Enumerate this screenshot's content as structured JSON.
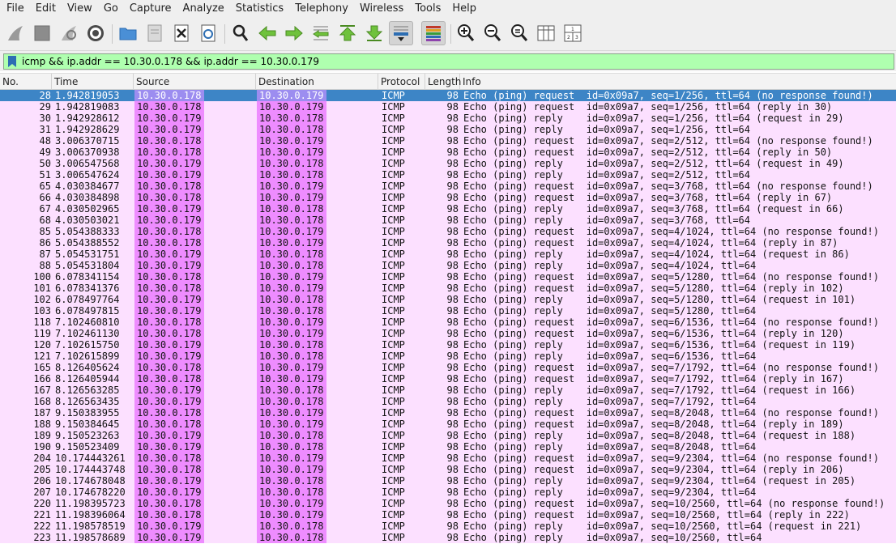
{
  "menubar": [
    "File",
    "Edit",
    "View",
    "Go",
    "Capture",
    "Analyze",
    "Statistics",
    "Telephony",
    "Wireless",
    "Tools",
    "Help"
  ],
  "toolbar": {
    "icons": [
      "shark-fin-start-icon",
      "stop-icon",
      "restart-icon",
      "options-gear-icon",
      "open-folder-icon",
      "save-file-icon",
      "close-file-icon",
      "reload-icon",
      "find-magnifier-icon",
      "go-back-arrow-icon",
      "go-forward-arrow-icon",
      "go-to-packet-icon",
      "go-first-icon",
      "go-last-icon",
      "autoscroll-icon",
      "colorize-icon",
      "zoom-in-icon",
      "zoom-out-icon",
      "zoom-normal-icon",
      "resize-columns-icon",
      "layout-icon"
    ]
  },
  "filter": {
    "value": "icmp && ip.addr == 10.30.0.178 && ip.addr == 10.30.0.179"
  },
  "columns": [
    "No.",
    "Time",
    "Source",
    "Destination",
    "Protocol",
    "Length",
    "Info"
  ],
  "packets": [
    {
      "no": "28",
      "time": "1.942819053",
      "src": "10.30.0.178",
      "dst": "10.30.0.179",
      "proto": "ICMP",
      "len": "98",
      "info": "Echo (ping) request  id=0x09a7, seq=1/256, ttl=64 (no response found!)",
      "selected": true
    },
    {
      "no": "29",
      "time": "1.942819083",
      "src": "10.30.0.178",
      "dst": "10.30.0.179",
      "proto": "ICMP",
      "len": "98",
      "info": "Echo (ping) request  id=0x09a7, seq=1/256, ttl=64 (reply in 30)"
    },
    {
      "no": "30",
      "time": "1.942928612",
      "src": "10.30.0.179",
      "dst": "10.30.0.178",
      "proto": "ICMP",
      "len": "98",
      "info": "Echo (ping) reply    id=0x09a7, seq=1/256, ttl=64 (request in 29)"
    },
    {
      "no": "31",
      "time": "1.942928629",
      "src": "10.30.0.179",
      "dst": "10.30.0.178",
      "proto": "ICMP",
      "len": "98",
      "info": "Echo (ping) reply    id=0x09a7, seq=1/256, ttl=64"
    },
    {
      "no": "48",
      "time": "3.006370715",
      "src": "10.30.0.178",
      "dst": "10.30.0.179",
      "proto": "ICMP",
      "len": "98",
      "info": "Echo (ping) request  id=0x09a7, seq=2/512, ttl=64 (no response found!)"
    },
    {
      "no": "49",
      "time": "3.006370938",
      "src": "10.30.0.178",
      "dst": "10.30.0.179",
      "proto": "ICMP",
      "len": "98",
      "info": "Echo (ping) request  id=0x09a7, seq=2/512, ttl=64 (reply in 50)"
    },
    {
      "no": "50",
      "time": "3.006547568",
      "src": "10.30.0.179",
      "dst": "10.30.0.178",
      "proto": "ICMP",
      "len": "98",
      "info": "Echo (ping) reply    id=0x09a7, seq=2/512, ttl=64 (request in 49)"
    },
    {
      "no": "51",
      "time": "3.006547624",
      "src": "10.30.0.179",
      "dst": "10.30.0.178",
      "proto": "ICMP",
      "len": "98",
      "info": "Echo (ping) reply    id=0x09a7, seq=2/512, ttl=64"
    },
    {
      "no": "65",
      "time": "4.030384677",
      "src": "10.30.0.178",
      "dst": "10.30.0.179",
      "proto": "ICMP",
      "len": "98",
      "info": "Echo (ping) request  id=0x09a7, seq=3/768, ttl=64 (no response found!)"
    },
    {
      "no": "66",
      "time": "4.030384898",
      "src": "10.30.0.178",
      "dst": "10.30.0.179",
      "proto": "ICMP",
      "len": "98",
      "info": "Echo (ping) request  id=0x09a7, seq=3/768, ttl=64 (reply in 67)"
    },
    {
      "no": "67",
      "time": "4.030502965",
      "src": "10.30.0.179",
      "dst": "10.30.0.178",
      "proto": "ICMP",
      "len": "98",
      "info": "Echo (ping) reply    id=0x09a7, seq=3/768, ttl=64 (request in 66)"
    },
    {
      "no": "68",
      "time": "4.030503021",
      "src": "10.30.0.179",
      "dst": "10.30.0.178",
      "proto": "ICMP",
      "len": "98",
      "info": "Echo (ping) reply    id=0x09a7, seq=3/768, ttl=64"
    },
    {
      "no": "85",
      "time": "5.054388333",
      "src": "10.30.0.178",
      "dst": "10.30.0.179",
      "proto": "ICMP",
      "len": "98",
      "info": "Echo (ping) request  id=0x09a7, seq=4/1024, ttl=64 (no response found!)"
    },
    {
      "no": "86",
      "time": "5.054388552",
      "src": "10.30.0.178",
      "dst": "10.30.0.179",
      "proto": "ICMP",
      "len": "98",
      "info": "Echo (ping) request  id=0x09a7, seq=4/1024, ttl=64 (reply in 87)"
    },
    {
      "no": "87",
      "time": "5.054531751",
      "src": "10.30.0.179",
      "dst": "10.30.0.178",
      "proto": "ICMP",
      "len": "98",
      "info": "Echo (ping) reply    id=0x09a7, seq=4/1024, ttl=64 (request in 86)"
    },
    {
      "no": "88",
      "time": "5.054531804",
      "src": "10.30.0.179",
      "dst": "10.30.0.178",
      "proto": "ICMP",
      "len": "98",
      "info": "Echo (ping) reply    id=0x09a7, seq=4/1024, ttl=64"
    },
    {
      "no": "100",
      "time": "6.078341154",
      "src": "10.30.0.178",
      "dst": "10.30.0.179",
      "proto": "ICMP",
      "len": "98",
      "info": "Echo (ping) request  id=0x09a7, seq=5/1280, ttl=64 (no response found!)"
    },
    {
      "no": "101",
      "time": "6.078341376",
      "src": "10.30.0.178",
      "dst": "10.30.0.179",
      "proto": "ICMP",
      "len": "98",
      "info": "Echo (ping) request  id=0x09a7, seq=5/1280, ttl=64 (reply in 102)"
    },
    {
      "no": "102",
      "time": "6.078497764",
      "src": "10.30.0.179",
      "dst": "10.30.0.178",
      "proto": "ICMP",
      "len": "98",
      "info": "Echo (ping) reply    id=0x09a7, seq=5/1280, ttl=64 (request in 101)"
    },
    {
      "no": "103",
      "time": "6.078497815",
      "src": "10.30.0.179",
      "dst": "10.30.0.178",
      "proto": "ICMP",
      "len": "98",
      "info": "Echo (ping) reply    id=0x09a7, seq=5/1280, ttl=64"
    },
    {
      "no": "118",
      "time": "7.102460810",
      "src": "10.30.0.178",
      "dst": "10.30.0.179",
      "proto": "ICMP",
      "len": "98",
      "info": "Echo (ping) request  id=0x09a7, seq=6/1536, ttl=64 (no response found!)"
    },
    {
      "no": "119",
      "time": "7.102461130",
      "src": "10.30.0.178",
      "dst": "10.30.0.179",
      "proto": "ICMP",
      "len": "98",
      "info": "Echo (ping) request  id=0x09a7, seq=6/1536, ttl=64 (reply in 120)"
    },
    {
      "no": "120",
      "time": "7.102615750",
      "src": "10.30.0.179",
      "dst": "10.30.0.178",
      "proto": "ICMP",
      "len": "98",
      "info": "Echo (ping) reply    id=0x09a7, seq=6/1536, ttl=64 (request in 119)"
    },
    {
      "no": "121",
      "time": "7.102615899",
      "src": "10.30.0.179",
      "dst": "10.30.0.178",
      "proto": "ICMP",
      "len": "98",
      "info": "Echo (ping) reply    id=0x09a7, seq=6/1536, ttl=64"
    },
    {
      "no": "165",
      "time": "8.126405624",
      "src": "10.30.0.178",
      "dst": "10.30.0.179",
      "proto": "ICMP",
      "len": "98",
      "info": "Echo (ping) request  id=0x09a7, seq=7/1792, ttl=64 (no response found!)"
    },
    {
      "no": "166",
      "time": "8.126405944",
      "src": "10.30.0.178",
      "dst": "10.30.0.179",
      "proto": "ICMP",
      "len": "98",
      "info": "Echo (ping) request  id=0x09a7, seq=7/1792, ttl=64 (reply in 167)"
    },
    {
      "no": "167",
      "time": "8.126563285",
      "src": "10.30.0.179",
      "dst": "10.30.0.178",
      "proto": "ICMP",
      "len": "98",
      "info": "Echo (ping) reply    id=0x09a7, seq=7/1792, ttl=64 (request in 166)"
    },
    {
      "no": "168",
      "time": "8.126563435",
      "src": "10.30.0.179",
      "dst": "10.30.0.178",
      "proto": "ICMP",
      "len": "98",
      "info": "Echo (ping) reply    id=0x09a7, seq=7/1792, ttl=64"
    },
    {
      "no": "187",
      "time": "9.150383955",
      "src": "10.30.0.178",
      "dst": "10.30.0.179",
      "proto": "ICMP",
      "len": "98",
      "info": "Echo (ping) request  id=0x09a7, seq=8/2048, ttl=64 (no response found!)"
    },
    {
      "no": "188",
      "time": "9.150384645",
      "src": "10.30.0.178",
      "dst": "10.30.0.179",
      "proto": "ICMP",
      "len": "98",
      "info": "Echo (ping) request  id=0x09a7, seq=8/2048, ttl=64 (reply in 189)"
    },
    {
      "no": "189",
      "time": "9.150523263",
      "src": "10.30.0.179",
      "dst": "10.30.0.178",
      "proto": "ICMP",
      "len": "98",
      "info": "Echo (ping) reply    id=0x09a7, seq=8/2048, ttl=64 (request in 188)"
    },
    {
      "no": "190",
      "time": "9.150523409",
      "src": "10.30.0.179",
      "dst": "10.30.0.178",
      "proto": "ICMP",
      "len": "98",
      "info": "Echo (ping) reply    id=0x09a7, seq=8/2048, ttl=64"
    },
    {
      "no": "204",
      "time": "10.174443261",
      "src": "10.30.0.178",
      "dst": "10.30.0.179",
      "proto": "ICMP",
      "len": "98",
      "info": "Echo (ping) request  id=0x09a7, seq=9/2304, ttl=64 (no response found!)"
    },
    {
      "no": "205",
      "time": "10.174443748",
      "src": "10.30.0.178",
      "dst": "10.30.0.179",
      "proto": "ICMP",
      "len": "98",
      "info": "Echo (ping) request  id=0x09a7, seq=9/2304, ttl=64 (reply in 206)"
    },
    {
      "no": "206",
      "time": "10.174678048",
      "src": "10.30.0.179",
      "dst": "10.30.0.178",
      "proto": "ICMP",
      "len": "98",
      "info": "Echo (ping) reply    id=0x09a7, seq=9/2304, ttl=64 (request in 205)"
    },
    {
      "no": "207",
      "time": "10.174678220",
      "src": "10.30.0.179",
      "dst": "10.30.0.178",
      "proto": "ICMP",
      "len": "98",
      "info": "Echo (ping) reply    id=0x09a7, seq=9/2304, ttl=64"
    },
    {
      "no": "220",
      "time": "11.198395723",
      "src": "10.30.0.178",
      "dst": "10.30.0.179",
      "proto": "ICMP",
      "len": "98",
      "info": "Echo (ping) request  id=0x09a7, seq=10/2560, ttl=64 (no response found!)"
    },
    {
      "no": "221",
      "time": "11.198396064",
      "src": "10.30.0.178",
      "dst": "10.30.0.179",
      "proto": "ICMP",
      "len": "98",
      "info": "Echo (ping) request  id=0x09a7, seq=10/2560, ttl=64 (reply in 222)"
    },
    {
      "no": "222",
      "time": "11.198578519",
      "src": "10.30.0.179",
      "dst": "10.30.0.178",
      "proto": "ICMP",
      "len": "98",
      "info": "Echo (ping) reply    id=0x09a7, seq=10/2560, ttl=64 (request in 221)"
    },
    {
      "no": "223",
      "time": "11.198578689",
      "src": "10.30.0.179",
      "dst": "10.30.0.178",
      "proto": "ICMP",
      "len": "98",
      "info": "Echo (ping) reply    id=0x09a7, seq=10/2560, ttl=64"
    }
  ]
}
